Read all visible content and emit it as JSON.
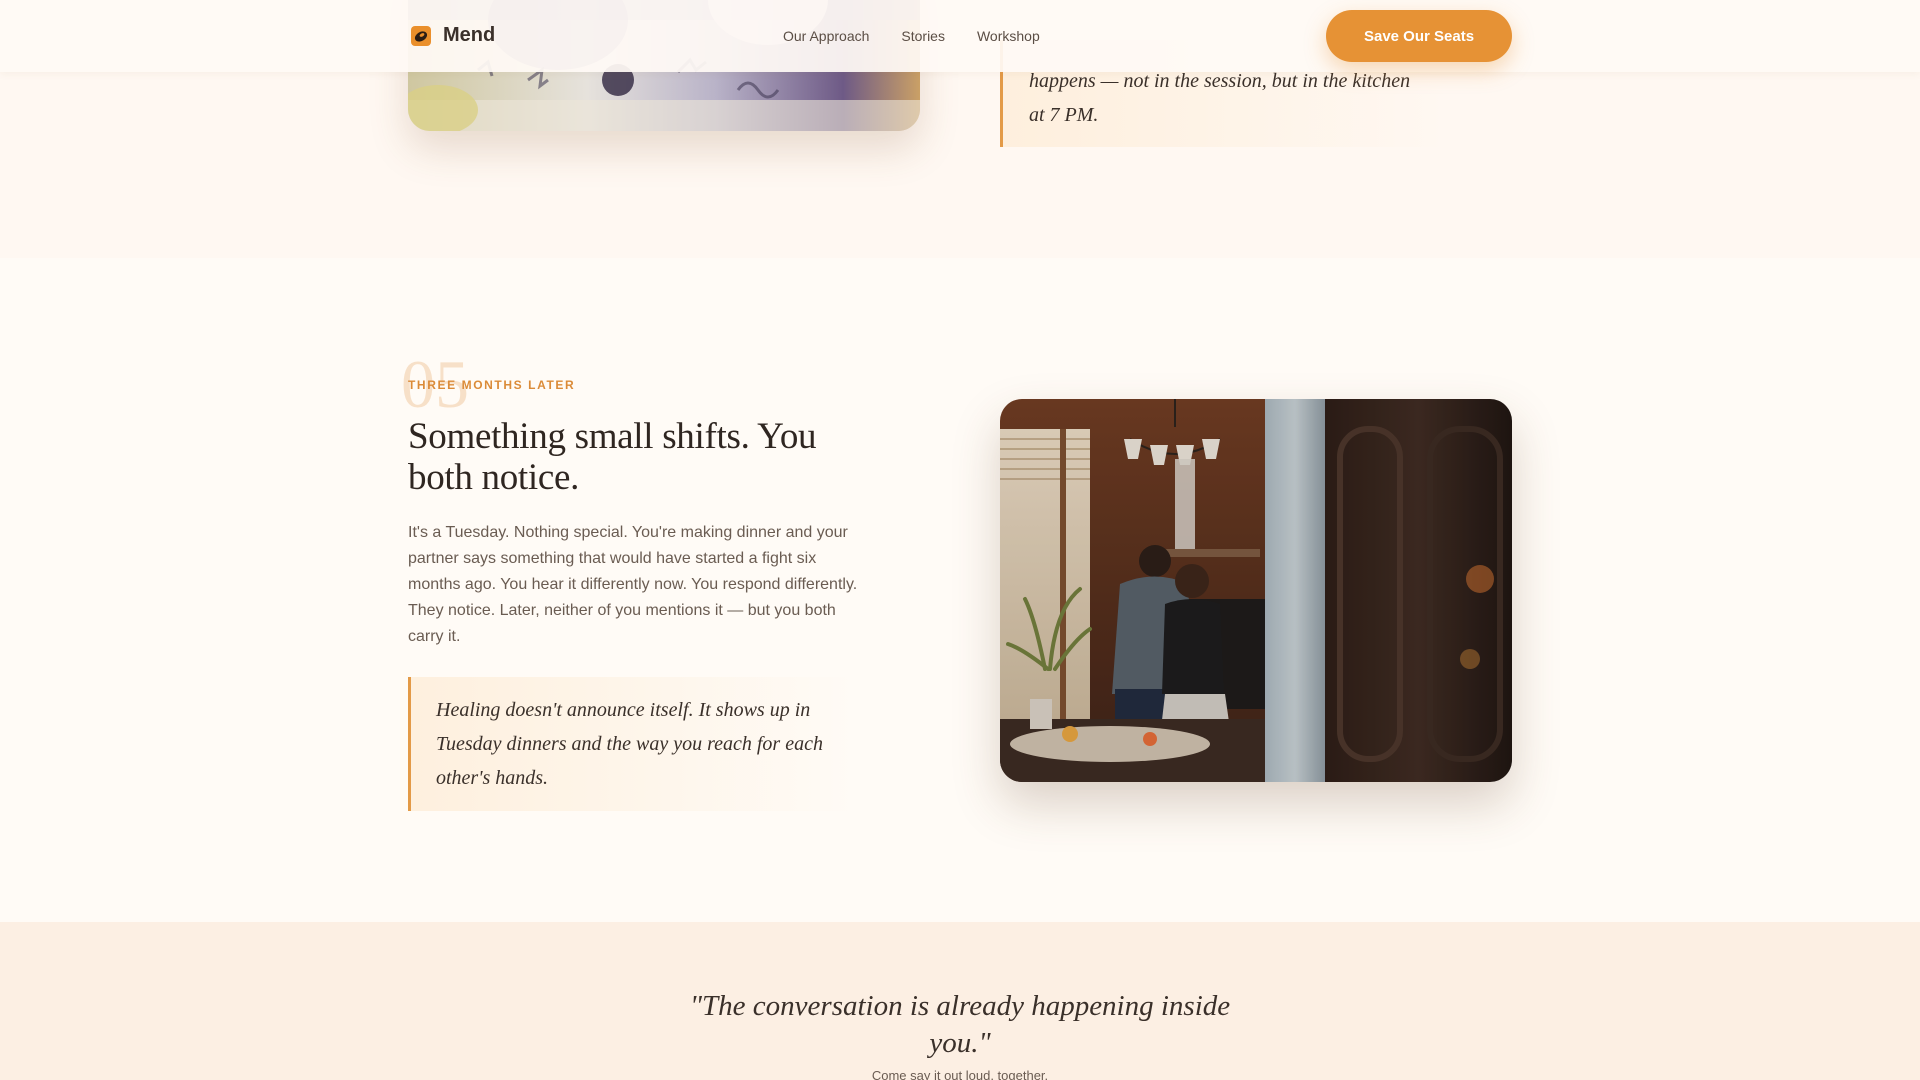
{
  "nav": {
    "brand": "Mend",
    "links": [
      "Our Approach",
      "Stories",
      "Workshop"
    ],
    "cta": "Save Our Seats"
  },
  "previous_step": {
    "quote_visible": "happens — not in the session, but in the kitchen at 7 PM."
  },
  "step": {
    "number": "05",
    "eyebrow": "THREE MONTHS LATER",
    "heading": "Something small shifts. You both notice.",
    "body": "It's a Tuesday. Nothing special. You're making dinner and your partner says something that would have started a fight six months ago. You hear it differently now. You respond differently. They notice. Later, neither of you mentions it — but you both carry it.",
    "quote": "Healing doesn't announce itself. It shows up in Tuesday dinners and the way you reach for each other's hands."
  },
  "closing": {
    "quote": "\"The conversation is already happening inside you.\"",
    "subtitle": "Come say it out loud, together."
  },
  "colors": {
    "accent": "#e69235",
    "eyebrow": "#db8b38",
    "background": "#fffbf6",
    "closing_background": "#fcefe3",
    "text": "#3a302a"
  },
  "icons": {
    "brand": "mend-logo-icon"
  }
}
